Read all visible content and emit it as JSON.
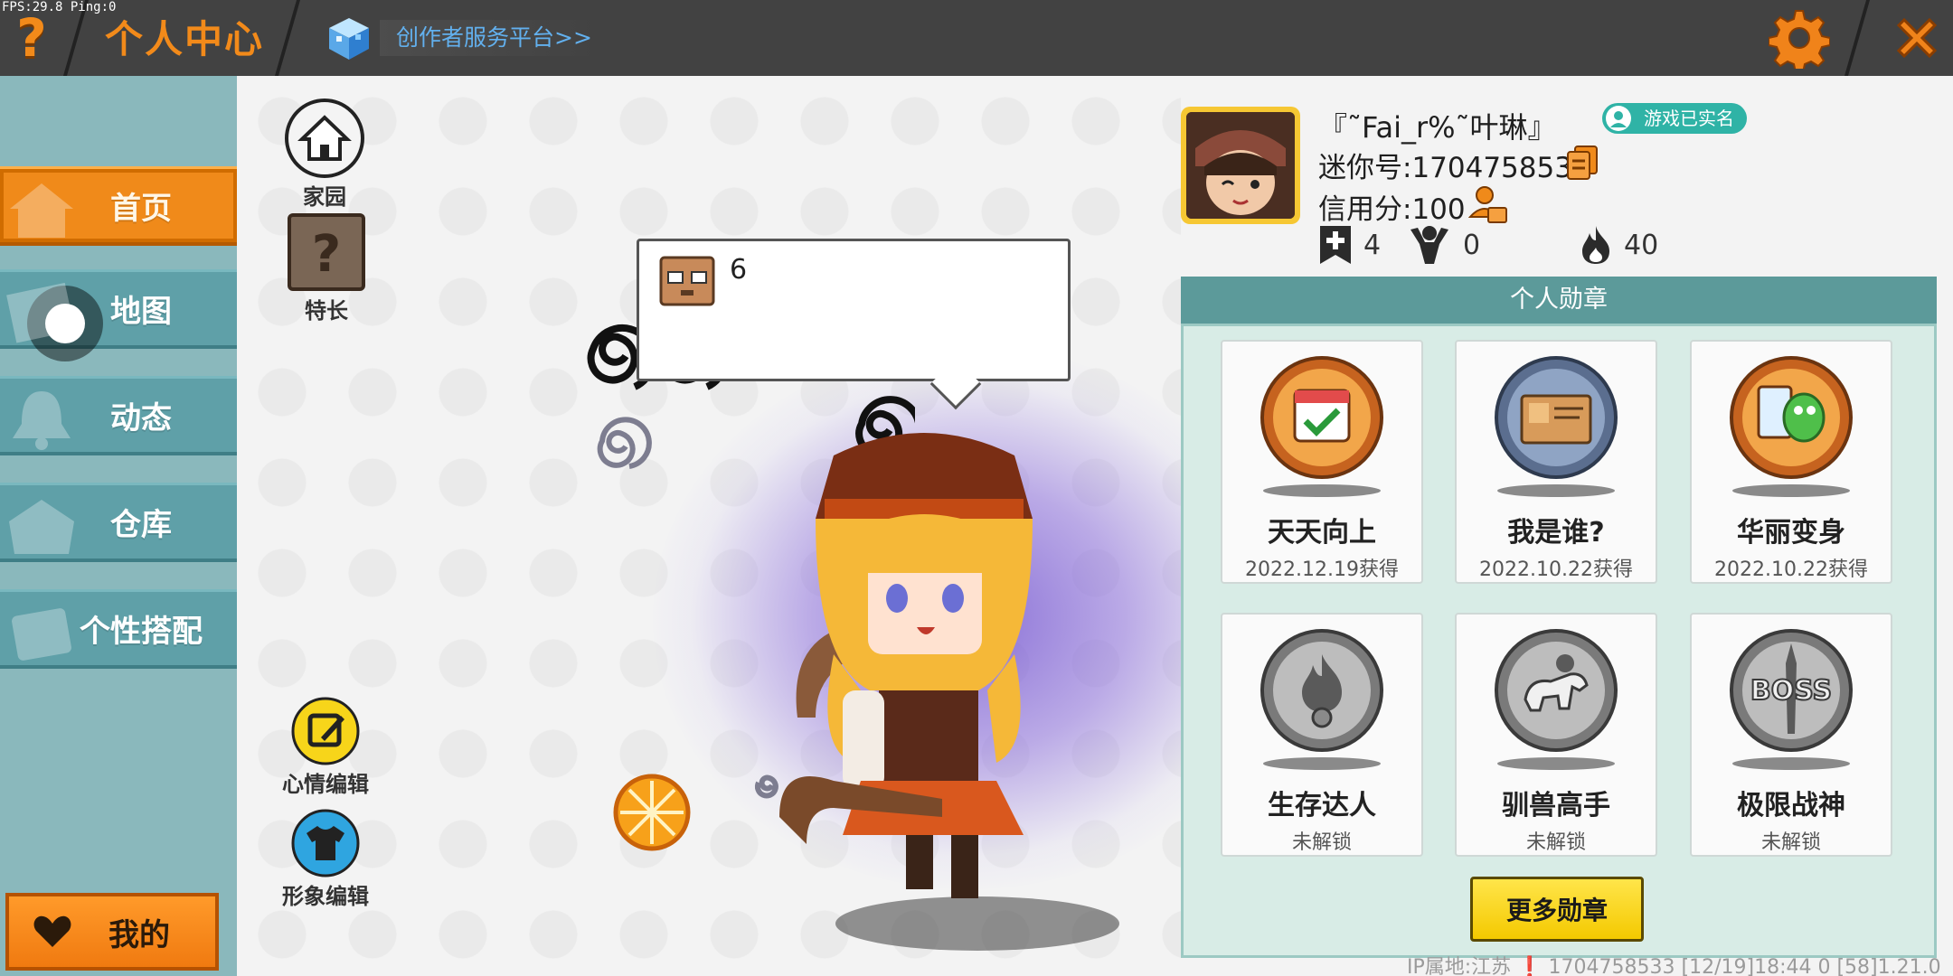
{
  "hud": {
    "fps": "FPS:29.8  Ping:0"
  },
  "topbar": {
    "help_label": "?",
    "title": "个人中心",
    "creator_link": "创作者服务平台>>"
  },
  "sidebar": {
    "items": [
      {
        "label": "首页",
        "icon": "home-icon",
        "active": true
      },
      {
        "label": "地图",
        "icon": "map-icon"
      },
      {
        "label": "动态",
        "icon": "bell-icon"
      },
      {
        "label": "仓库",
        "icon": "warehouse-icon"
      },
      {
        "label": "个性搭配",
        "icon": "outfit-icon"
      }
    ],
    "mine_label": "我的"
  },
  "center": {
    "home_label": "家园",
    "talent_label": "特长",
    "mood_label": "心情编辑",
    "appearance_label": "形象编辑",
    "speech_count": "6"
  },
  "profile": {
    "nickname": "『˜Fai_r%˜叶琳』",
    "verified_label": "游戏已实名",
    "mini_id_line": "迷你号:1704758533",
    "credit_line": "信用分:100",
    "stats": {
      "adds": "4",
      "fans": "0",
      "heat": "40"
    }
  },
  "medals": {
    "header": "个人勋章",
    "items": [
      {
        "name": "天天向上",
        "sub": "2022.12.19获得",
        "unlocked": true,
        "color": "#e67a2e"
      },
      {
        "name": "我是谁?",
        "sub": "2022.10.22获得",
        "unlocked": true,
        "color": "#4a6aa8"
      },
      {
        "name": "华丽变身",
        "sub": "2022.10.22获得",
        "unlocked": true,
        "color": "#e67a2e"
      },
      {
        "name": "生存达人",
        "sub": "未解锁",
        "unlocked": false,
        "color": "#8a8a8a"
      },
      {
        "name": "驯兽高手",
        "sub": "未解锁",
        "unlocked": false,
        "color": "#8a8a8a"
      },
      {
        "name": "极限战神",
        "sub": "未解锁",
        "unlocked": false,
        "color": "#8a8a8a"
      }
    ],
    "more_label": "更多勋章"
  },
  "footer": {
    "text": "IP属地:江苏 ❗    1704758533   [12/19]18:44 0  [58]1.21.0"
  },
  "colors": {
    "accent": "#f08a1a",
    "teal": "#5fa0a8",
    "medal_header": "#5c9a9a",
    "gold_button": "#f4c900"
  }
}
